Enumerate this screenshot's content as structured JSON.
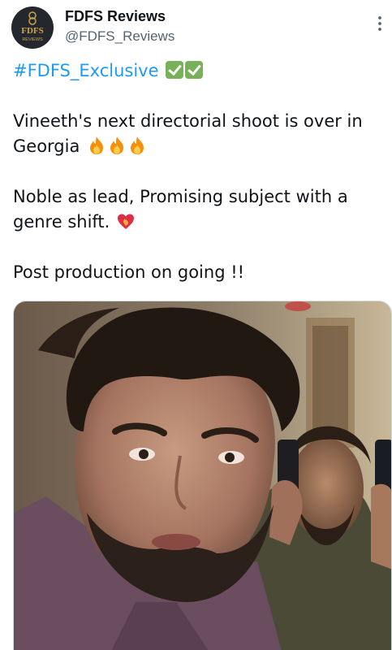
{
  "author": {
    "display_name": "FDFS Reviews",
    "handle": "@FDFS_Reviews",
    "avatar_text": "FDFS",
    "avatar_subtext": "REVIEWS"
  },
  "tweet": {
    "hashtag": "#FDFS_Exclusive",
    "line1": "Vineeth's next directorial shoot is over in Georgia",
    "line2": "Noble as lead, Promising subject with a genre shift.",
    "line3": "Post production on going !!"
  },
  "icons": {
    "more": "more-options-icon",
    "check": "check-mark-button-emoji",
    "fire": "fire-emoji",
    "heart": "heart-on-fire-emoji"
  },
  "colors": {
    "hashtag": "#1d9bf0",
    "handle": "#536471",
    "check": "#78b159"
  },
  "media": {
    "alt": "Photo of a bearded man in a dark room with another man holding a phone behind him"
  }
}
